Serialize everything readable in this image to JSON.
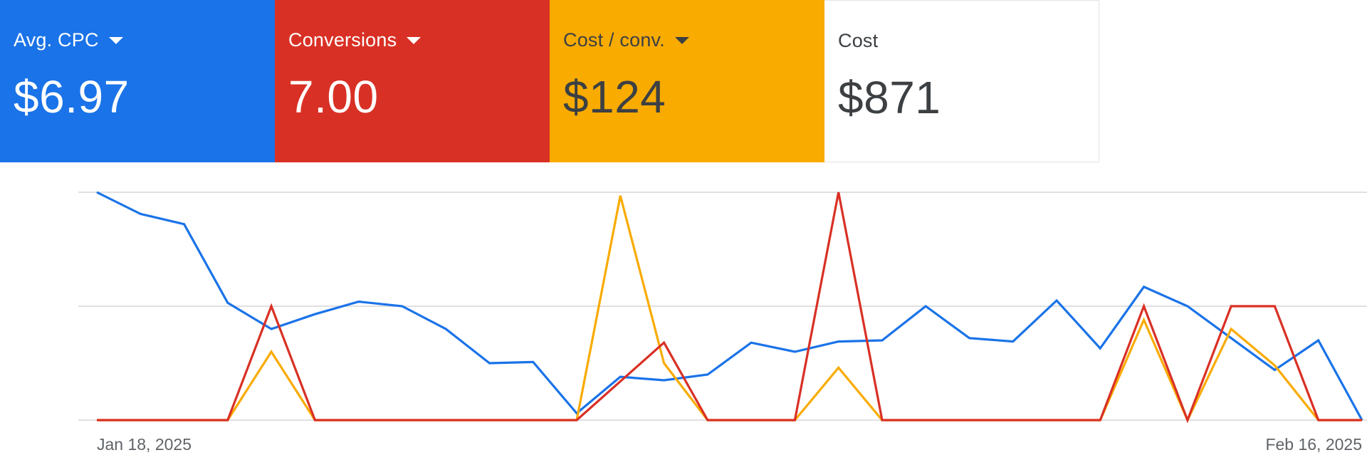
{
  "metrics": [
    {
      "label": "Avg. CPC",
      "value": "$6.97",
      "bg": "#1a73e8",
      "fg": "#ffffff",
      "has_dropdown": true
    },
    {
      "label": "Conversions",
      "value": "7.00",
      "bg": "#d93025",
      "fg": "#ffffff",
      "has_dropdown": true
    },
    {
      "label": "Cost / conv.",
      "value": "$124",
      "bg": "#f9ab00",
      "fg": "#3c4043",
      "has_dropdown": true
    },
    {
      "label": "Cost",
      "value": "$871",
      "bg": "#ffffff",
      "fg": "#3c4043",
      "has_dropdown": false
    }
  ],
  "chart_data": {
    "type": "line",
    "x_start_label": "Jan 18, 2025",
    "x_end_label": "Feb 16, 2025",
    "grid": true,
    "y_normalized_scale": [
      0,
      1
    ],
    "series": [
      {
        "metric": "Avg. CPC",
        "color": "#1a73e8",
        "values": [
          1.0,
          0.905,
          0.86,
          0.515,
          0.4,
          0.465,
          0.52,
          0.5,
          0.4,
          0.25,
          0.255,
          0.03,
          0.19,
          0.175,
          0.2,
          0.34,
          0.3,
          0.345,
          0.35,
          0.5,
          0.36,
          0.345,
          0.525,
          0.315,
          0.585,
          0.5,
          0.36,
          0.22,
          0.35,
          0.0
        ]
      },
      {
        "metric": "Conversions",
        "color": "#d93025",
        "values": [
          0,
          0,
          0,
          0,
          0.5,
          0,
          0,
          0,
          0,
          0,
          0,
          0,
          0.17,
          0.34,
          0,
          0,
          0,
          1.0,
          0,
          0,
          0,
          0,
          0,
          0,
          0.5,
          0,
          0.5,
          0.5,
          0,
          0
        ]
      },
      {
        "metric": "Cost / conv.",
        "color": "#f9ab00",
        "values": [
          0,
          0,
          0,
          0,
          0.3,
          0,
          0,
          0,
          0,
          0,
          0,
          0,
          0.985,
          0.25,
          0,
          0,
          0,
          0.23,
          0,
          0,
          0,
          0,
          0,
          0,
          0.44,
          0,
          0.4,
          0.24,
          0,
          0
        ]
      }
    ]
  },
  "style": {
    "grid_color": "#e0e0e0",
    "tick_color": "#5f6368"
  }
}
